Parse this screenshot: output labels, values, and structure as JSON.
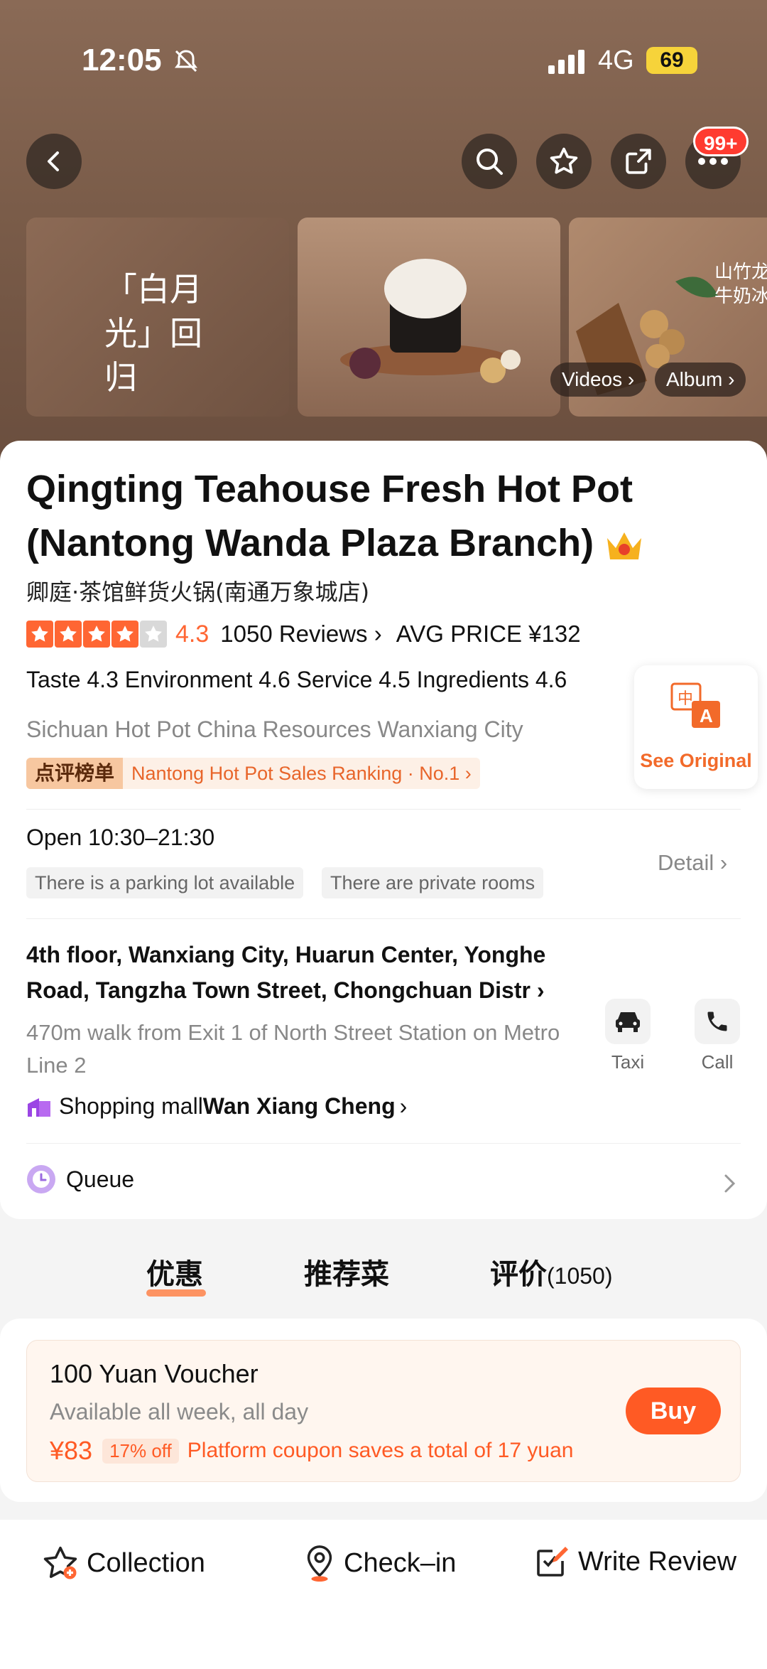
{
  "status": {
    "time": "12:05",
    "network": "4G",
    "battery": "69"
  },
  "header": {
    "more_badge": "99+"
  },
  "gallery": {
    "img1_text": "「白月光」回归",
    "img3_text": "山竹龙 牛奶冰",
    "videos_label": "Videos",
    "album_label": "Album"
  },
  "shop": {
    "title": "Qingting Teahouse Fresh Hot Pot (Nantong Wanda Plaza Branch)",
    "original_name": "卿庭·茶馆鲜货火锅(南通万象城店)",
    "score": "4.3",
    "reviews": "1050 Reviews",
    "avg_price": "AVG PRICE ¥132",
    "subscores": "Taste 4.3  Environment 4.6  Service 4.5  Ingredients 4.6",
    "tags": "Sichuan Hot Pot  China Resources Wanxiang City",
    "rank_label": "点评榜单",
    "rank_text": "Nantong Hot Pot Sales Ranking · No.1",
    "see_original": "See Original",
    "open_hours": "Open  10:30–21:30",
    "chip1": "There is a parking lot available",
    "chip2": "There are private rooms",
    "detail": "Detail",
    "address": "4th floor, Wanxiang City, Huarun Center, Yonghe Road, Tangzha Town Street, Chongchuan Distr",
    "walk": "470m walk from Exit 1 of North Street Station on Metro Line 2",
    "taxi": "Taxi",
    "call": "Call",
    "mall_prefix": "Shopping mall",
    "mall_name": "Wan Xiang Cheng",
    "queue": "Queue"
  },
  "tabs": [
    {
      "label": "优惠"
    },
    {
      "label": "推荐菜"
    },
    {
      "label": "评价",
      "count": "(1050)"
    }
  ],
  "voucher": {
    "title": "100 Yuan Voucher",
    "subtitle": "Available all week, all day",
    "price": "¥83",
    "discount": "17% off",
    "saving": "Platform coupon saves a total of 17 yuan",
    "buy": "Buy"
  },
  "bottom": {
    "collection": "Collection",
    "checkin": "Check–in",
    "review": "Write Review"
  },
  "colors": {
    "accent": "#ff5a24",
    "star": "#ff6633",
    "hero": "#7a5c49"
  }
}
